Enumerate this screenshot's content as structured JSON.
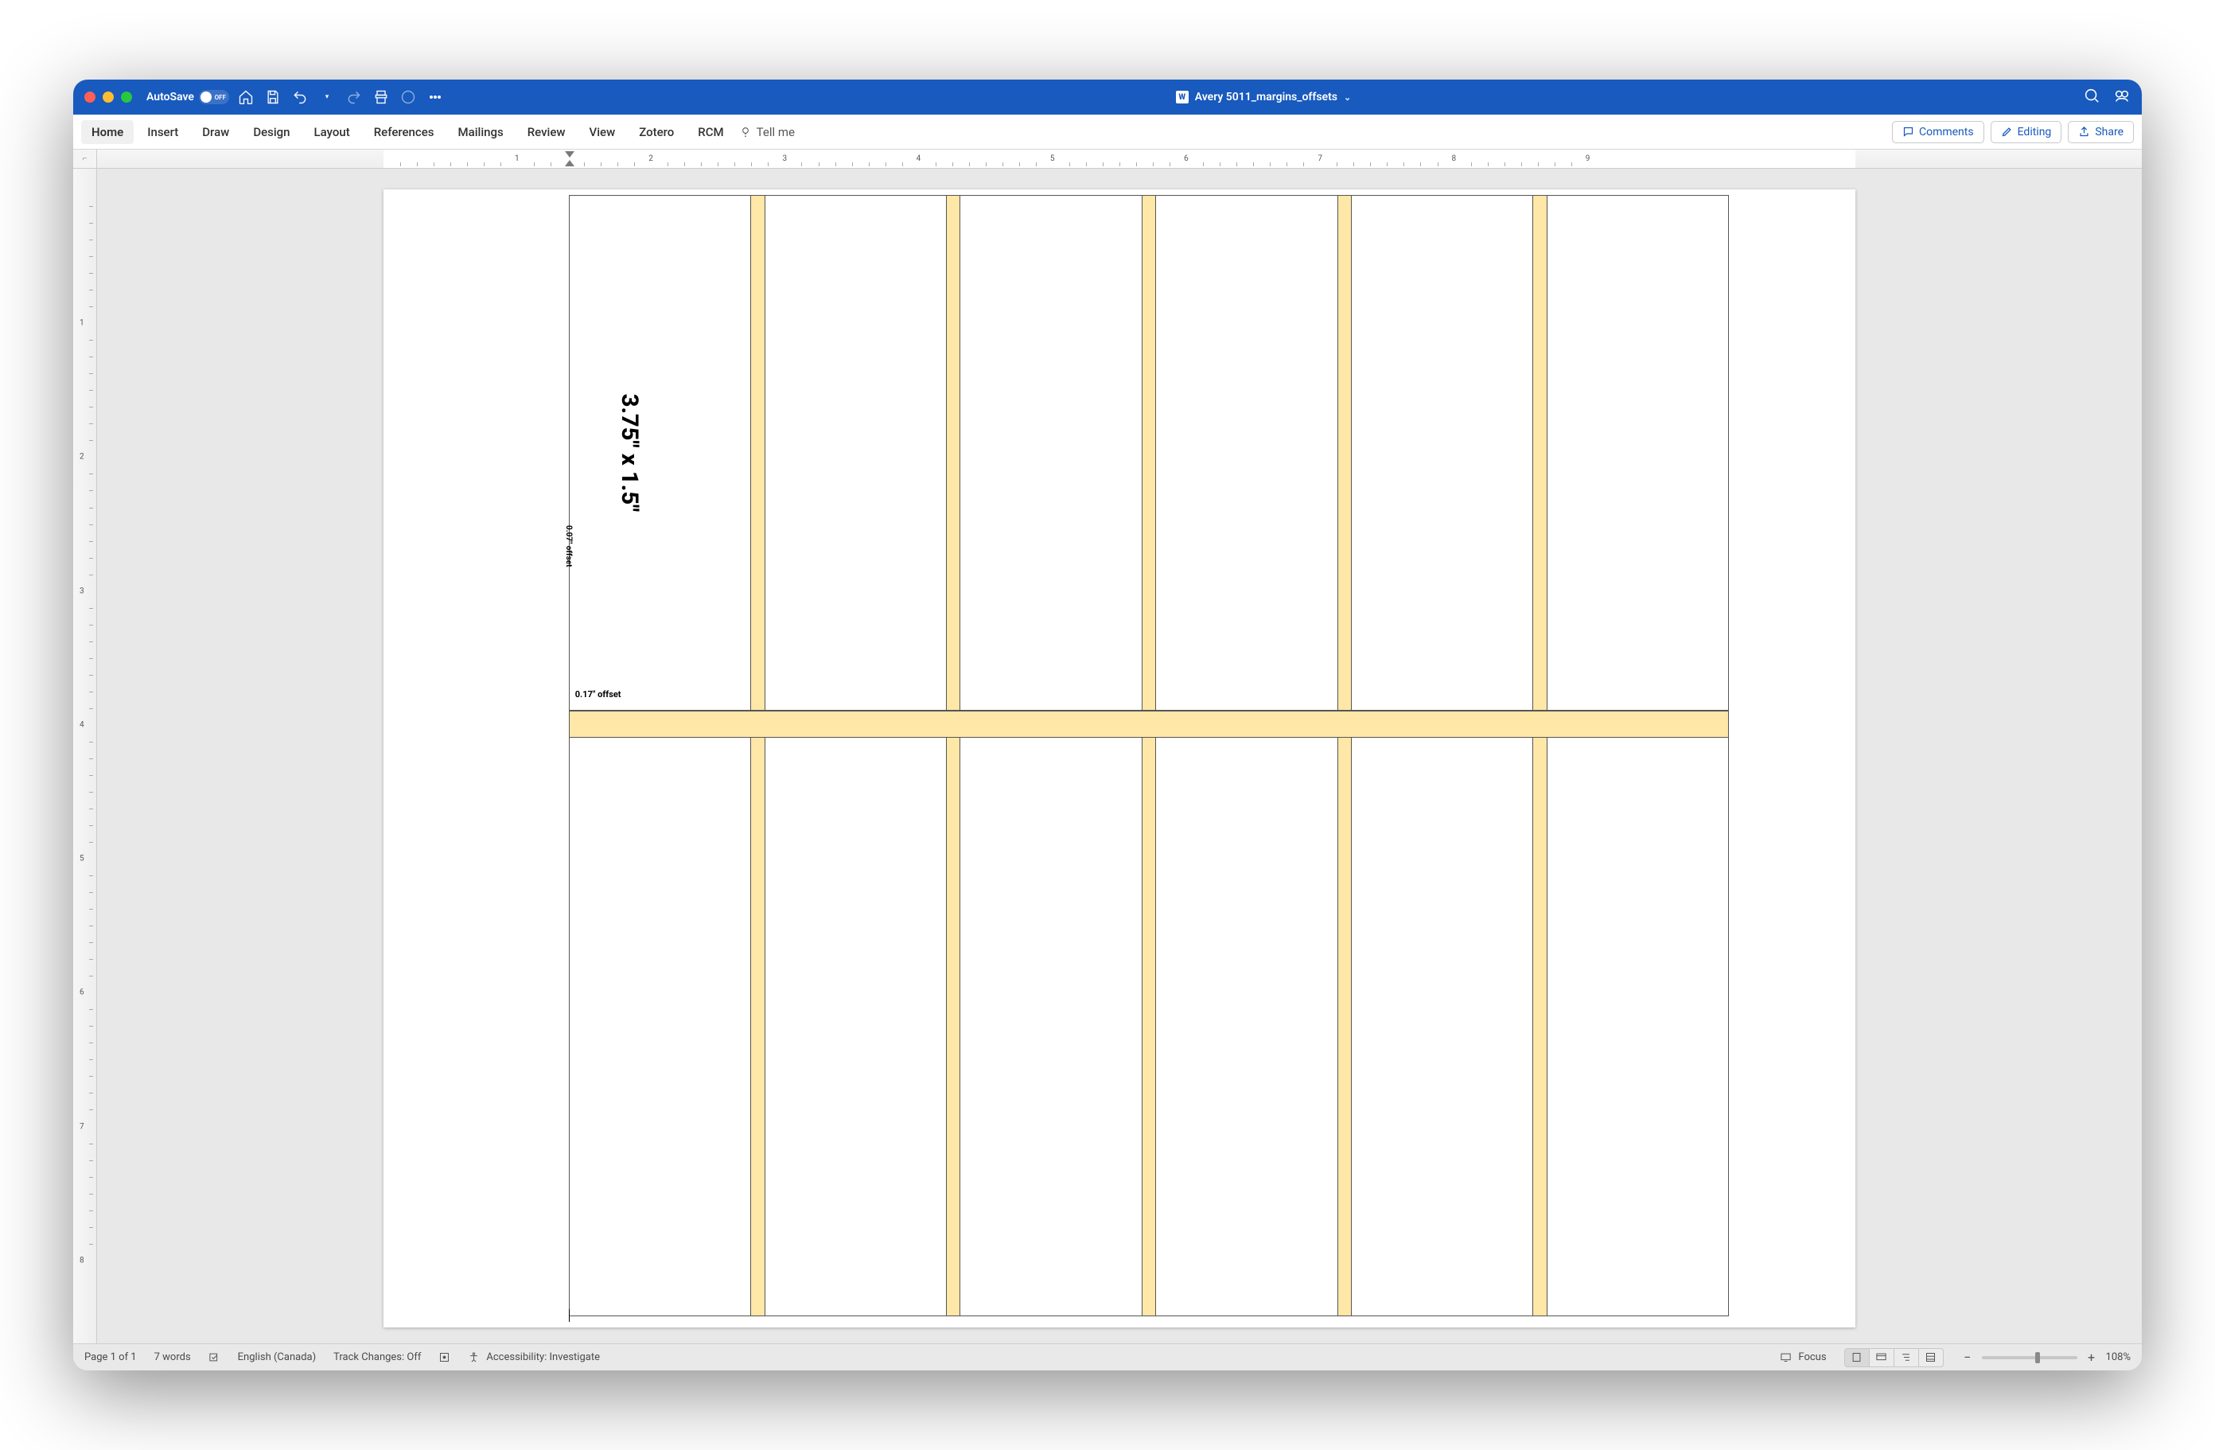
{
  "titlebar": {
    "autosave_label": "AutoSave",
    "autosave_state": "OFF",
    "doc_title": "Avery 5011_margins_offsets"
  },
  "icons": {
    "home": "home-icon",
    "save": "save-icon",
    "undo": "undo-icon",
    "redo": "redo-icon",
    "print": "print-icon",
    "touch": "touch-icon",
    "more": "more-icon",
    "search": "search-icon",
    "copilot": "copilot-icon"
  },
  "ribbon": {
    "tabs": [
      "Home",
      "Insert",
      "Draw",
      "Design",
      "Layout",
      "References",
      "Mailings",
      "Review",
      "View",
      "Zotero",
      "RCM"
    ],
    "active_index": 0,
    "tell_me": "Tell me",
    "comments": "Comments",
    "editing": "Editing",
    "share": "Share"
  },
  "ruler": {
    "h_numbers": [
      "1",
      "2",
      "3",
      "4",
      "5",
      "6",
      "7",
      "8",
      "9"
    ],
    "v_numbers": [
      "1",
      "2",
      "3",
      "4",
      "5",
      "6",
      "7",
      "8"
    ]
  },
  "document": {
    "cell_dimension": "3.75\" x 1.5\"",
    "offset_vertical": "0.07\" offset",
    "offset_horizontal": "0.17\" offset"
  },
  "statusbar": {
    "page": "Page 1 of 1",
    "words": "7 words",
    "language": "English (Canada)",
    "track_changes": "Track Changes: Off",
    "accessibility": "Accessibility: Investigate",
    "focus": "Focus",
    "zoom": "108%"
  }
}
